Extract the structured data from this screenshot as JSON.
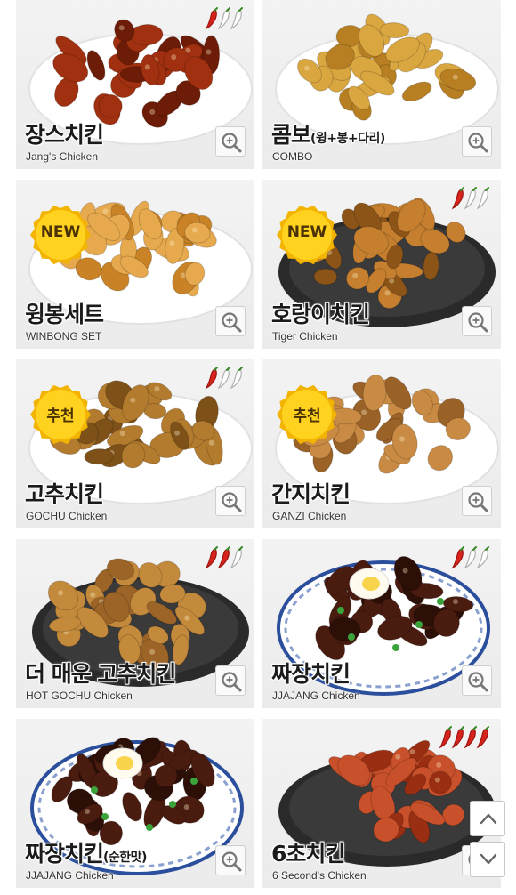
{
  "menu": [
    {
      "ko": "장스치킨",
      "ko_sub": "",
      "en": "Jang's Chicken",
      "badge": "",
      "spice": 1,
      "spice_total": 3,
      "plate": "white",
      "sauce": "#a0300f",
      "sauce2": "#6d1c07"
    },
    {
      "ko": "콤보",
      "ko_sub": "(윙+봉+다리)",
      "en": "COMBO",
      "badge": "",
      "spice": 0,
      "spice_total": 0,
      "plate": "white",
      "sauce": "#d9a640",
      "sauce2": "#b77f22"
    },
    {
      "ko": "윙봉세트",
      "ko_sub": "",
      "en": "WINBONG SET",
      "badge": "NEW",
      "spice": 0,
      "spice_total": 0,
      "plate": "white",
      "sauce": "#e7a94d",
      "sauce2": "#c98326"
    },
    {
      "ko": "호랑이치킨",
      "ko_sub": "",
      "en": "Tiger Chicken",
      "badge": "NEW",
      "spice": 1,
      "spice_total": 3,
      "plate": "black",
      "sauce": "#c57f2f",
      "sauce2": "#8d5417"
    },
    {
      "ko": "고추치킨",
      "ko_sub": "",
      "en": "GOCHU Chicken",
      "badge": "추천",
      "spice": 1,
      "spice_total": 3,
      "plate": "white",
      "sauce": "#b37b2e",
      "sauce2": "#7e5119"
    },
    {
      "ko": "간지치킨",
      "ko_sub": "",
      "en": "GANZI Chicken",
      "badge": "추천",
      "spice": 0,
      "spice_total": 0,
      "plate": "white",
      "sauce": "#c98b44",
      "sauce2": "#9a6227"
    },
    {
      "ko": "더 매운 고추치킨",
      "ko_sub": "",
      "en": "HOT GOCHU Chicken",
      "badge": "",
      "spice": 2,
      "spice_total": 3,
      "plate": "black",
      "sauce": "#c48a3c",
      "sauce2": "#9c6427"
    },
    {
      "ko": "짜장치킨",
      "ko_sub": "",
      "en": "JJAJANG Chicken",
      "badge": "",
      "spice": 1,
      "spice_total": 3,
      "plate": "blue",
      "sauce": "#4a1c10",
      "sauce2": "#2c0f07"
    },
    {
      "ko": "짜장치킨",
      "ko_sub": "(순한맛)",
      "en": "JJAJANG Chicken",
      "badge": "",
      "spice": 0,
      "spice_total": 0,
      "plate": "blue",
      "sauce": "#4a1c10",
      "sauce2": "#2c0f07"
    },
    {
      "ko": "6초치킨",
      "ko_sub": "",
      "en": "6 Second's Chicken",
      "badge": "",
      "spice": 4,
      "spice_total": 4,
      "plate": "black",
      "sauce": "#c8502a",
      "sauce2": "#9a2e12"
    }
  ],
  "icons": {
    "zoom": "magnifier-plus-icon",
    "pepper": "chili-pepper-icon",
    "scroll_up": "chevron-up-icon",
    "scroll_down": "chevron-down-icon"
  },
  "colors": {
    "badge_fill": "#ffd21f",
    "badge_edge": "#f2b400",
    "pepper_red": "#d8231c",
    "pepper_outline": "#b0b0b0"
  }
}
